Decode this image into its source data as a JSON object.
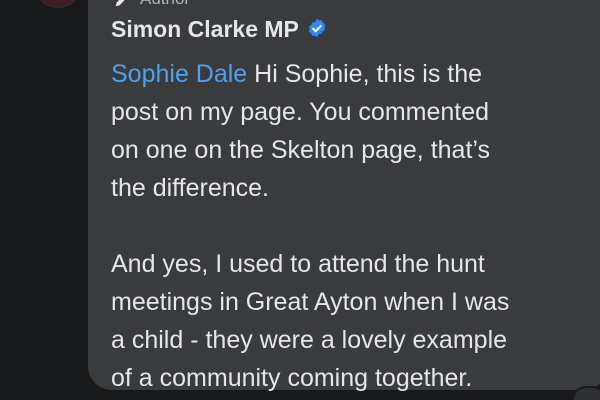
{
  "comment": {
    "role_badge": "Author",
    "author": "Simon Clarke MP",
    "mention": "Sophie Dale",
    "body_lines": [
      "Hi Sophie, this is the",
      "post on my page.  You commented",
      "on one on the Skelton page, that’s",
      "the difference.",
      "",
      "And yes, I used to attend the hunt",
      "meetings in Great Ayton when I was",
      "a child - they were a lovely example",
      "of a community coming together."
    ]
  },
  "colors": {
    "background": "#18191a",
    "bubble": "#3a3b3c",
    "text": "#e4e6eb",
    "mention": "#4ea0f0",
    "verified": "#2d88ff"
  },
  "icons": {
    "role": "pencil-icon",
    "verified": "verified-badge-icon"
  }
}
